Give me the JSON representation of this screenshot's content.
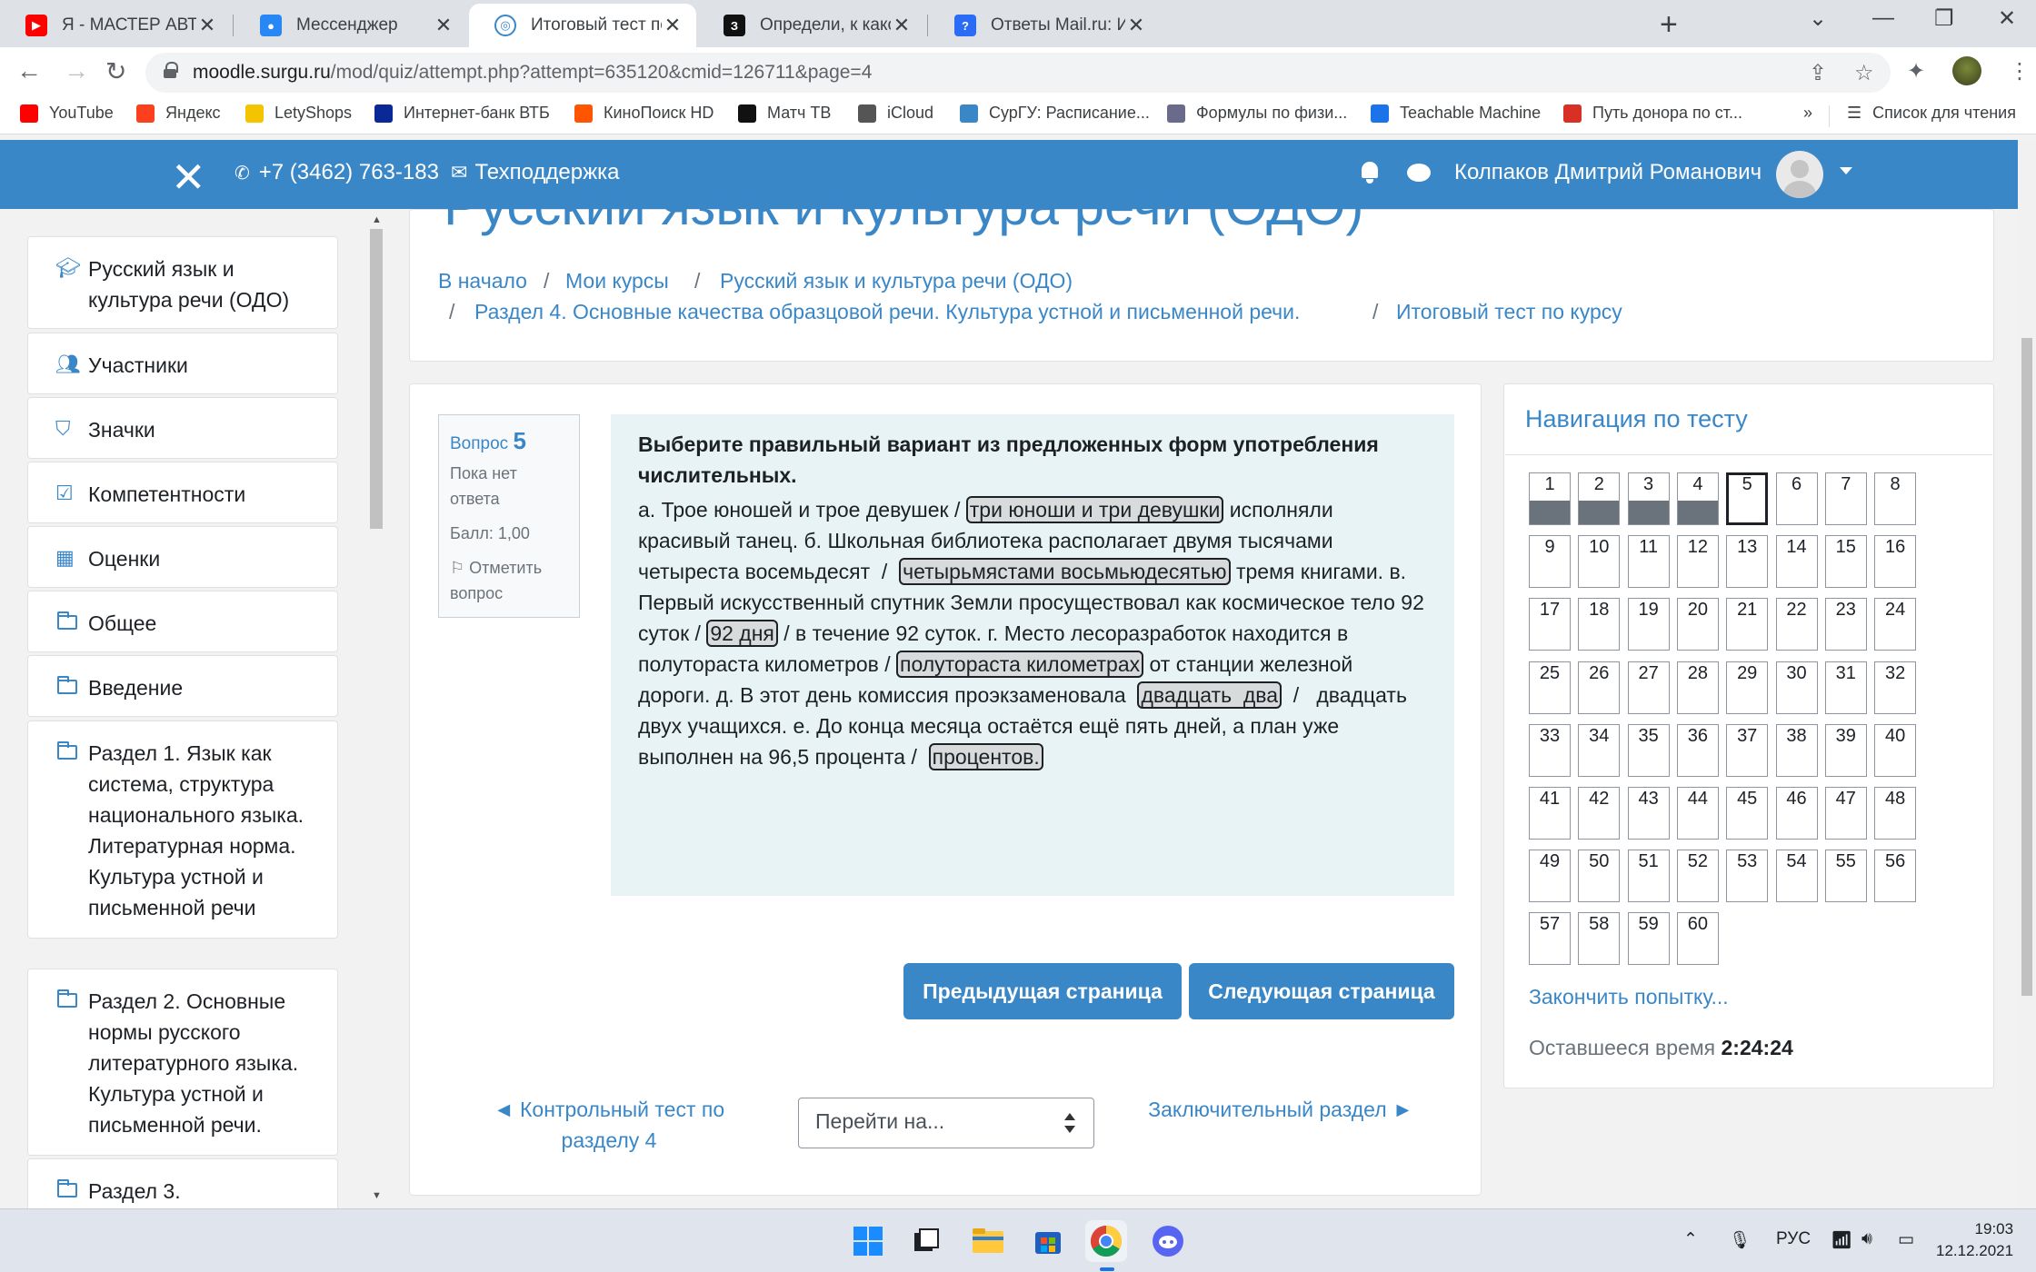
{
  "browser": {
    "tabs": [
      {
        "title": "Я - МАСТЕР АВТОСПОРТА! (нет)",
        "icon": "youtube-icon",
        "color": "#ff0000"
      },
      {
        "title": "Мессенджер",
        "icon": "messenger-icon",
        "color": "#2787f5"
      },
      {
        "title": "Итоговый тест по курсу (страни",
        "icon": "moodle-icon",
        "color": "#3a87c8"
      },
      {
        "title": "Определи, к какому стилю отно",
        "icon": "znanija-icon",
        "color": "#111111"
      },
      {
        "title": "Ответы Mail.ru: Исправьте ошиб",
        "icon": "mailru-answers-icon",
        "color": "#2b6cf6"
      }
    ],
    "url_domain": "moodle.surgu.ru",
    "url_path": "/mod/quiz/attempt.php?attempt=635120&cmid=126711&page=4",
    "bookmarks": [
      {
        "label": "YouTube",
        "icon": "youtube-icon",
        "color": "#ff0000"
      },
      {
        "label": "Яндекс",
        "icon": "yandex-icon",
        "color": "#fc3f1d"
      },
      {
        "label": "LetyShops",
        "icon": "letyshops-icon",
        "color": "#f5c400"
      },
      {
        "label": "Интернет-банк ВТБ",
        "icon": "vtb-icon",
        "color": "#0a2896"
      },
      {
        "label": "КиноПоиск HD",
        "icon": "kinopoisk-icon",
        "color": "#ff5500"
      },
      {
        "label": "Матч ТВ",
        "icon": "matchtv-icon",
        "color": "#111111"
      },
      {
        "label": "iCloud",
        "icon": "apple-icon",
        "color": "#555555"
      },
      {
        "label": "СурГУ: Расписание...",
        "icon": "surgu-icon",
        "color": "#3a87c8"
      },
      {
        "label": "Формулы по физи...",
        "icon": "physics-icon",
        "color": "#6a6a8a"
      },
      {
        "label": "Teachable Machine",
        "icon": "teachable-icon",
        "color": "#1a73e8"
      },
      {
        "label": "Путь донора по ст...",
        "icon": "donor-icon",
        "color": "#d93025"
      }
    ],
    "bookmarks_more": "»",
    "reading_list": "Список для чтения"
  },
  "moodle": {
    "phone": "+7 (3462) 763-183",
    "support": "Техподдержка",
    "user_name": "Колпаков Дмитрий Романович",
    "course_title": "Русский язык и культура речи (ОДО)",
    "breadcrumb": {
      "home": "В начало",
      "my_courses": "Мои курсы",
      "course": "Русский язык и культура речи (ОДО)",
      "section": "Раздел 4. Основные качества образцовой речи. Культура устной и письменной речи.",
      "quiz": "Итоговый тест по курсу"
    },
    "sidebar": [
      "Русский язык и культура речи (ОДО)",
      "Участники",
      "Значки",
      "Компетентности",
      "Оценки",
      "Общее",
      "Введение",
      "Раздел 1. Язык как система, структура национального языка. Литературная норма. Культура устной и письменной речи",
      "Раздел 2. Основные нормы русского литературного языка. Культура устной и письменной речи.",
      "Раздел 3."
    ],
    "question": {
      "label": "Вопрос",
      "number": "5",
      "status": "Пока нет ответа",
      "grade": "Балл: 1,00",
      "flag": "Отметить вопрос",
      "stem": "Выберите правильный вариант из предложенных форм употребления числительных.",
      "body": [
        {
          "t": "а. Трое юношей и трое девушек / "
        },
        {
          "t": "три юноши и три девушки",
          "sel": true
        },
        {
          "t": " исполняли красивый танец. б. Школьная библиотека располагает двумя тысячами четыреста восемьдесят  /  "
        },
        {
          "t": "четырьмястами восьмьюдесятью",
          "sel": true
        },
        {
          "t": " тремя книгами. в. Первый искусственный спутник Земли просуществовал как космическое тело 92 суток / "
        },
        {
          "t": "92 дня",
          "sel": true
        },
        {
          "t": " / в течение 92 суток. г. Место лесоразработок находится в полутораста километров / "
        },
        {
          "t": "полутораста километрах",
          "sel": true
        },
        {
          "t": " от станции железной дороги. д. В этот день комиссия проэкзаменовала  "
        },
        {
          "t": "двадцать  два",
          "sel": true
        },
        {
          "t": "  /   двадцать двух учащихся. е. До конца месяца остаётся ещё пять дней, а план уже выполнен на 96,5 процента /  "
        },
        {
          "t": "процентов.",
          "sel": true
        }
      ]
    },
    "buttons": {
      "prev": "Предыдущая страница",
      "next": "Следующая страница"
    },
    "prev_activity": "◄ Контрольный тест по разделу 4",
    "jump_placeholder": "Перейти на...",
    "next_activity": "Заключительный раздел ►",
    "quiz_nav": {
      "title": "Навигация по тесту",
      "total": 60,
      "answered": [
        1,
        2,
        3,
        4
      ],
      "current": 5,
      "finish": "Закончить попытку...",
      "time_label": "Оставшееся время",
      "time_value": "2:24:24"
    }
  },
  "taskbar": {
    "lang": "РУС",
    "time": "19:03",
    "date": "12.12.2021"
  }
}
